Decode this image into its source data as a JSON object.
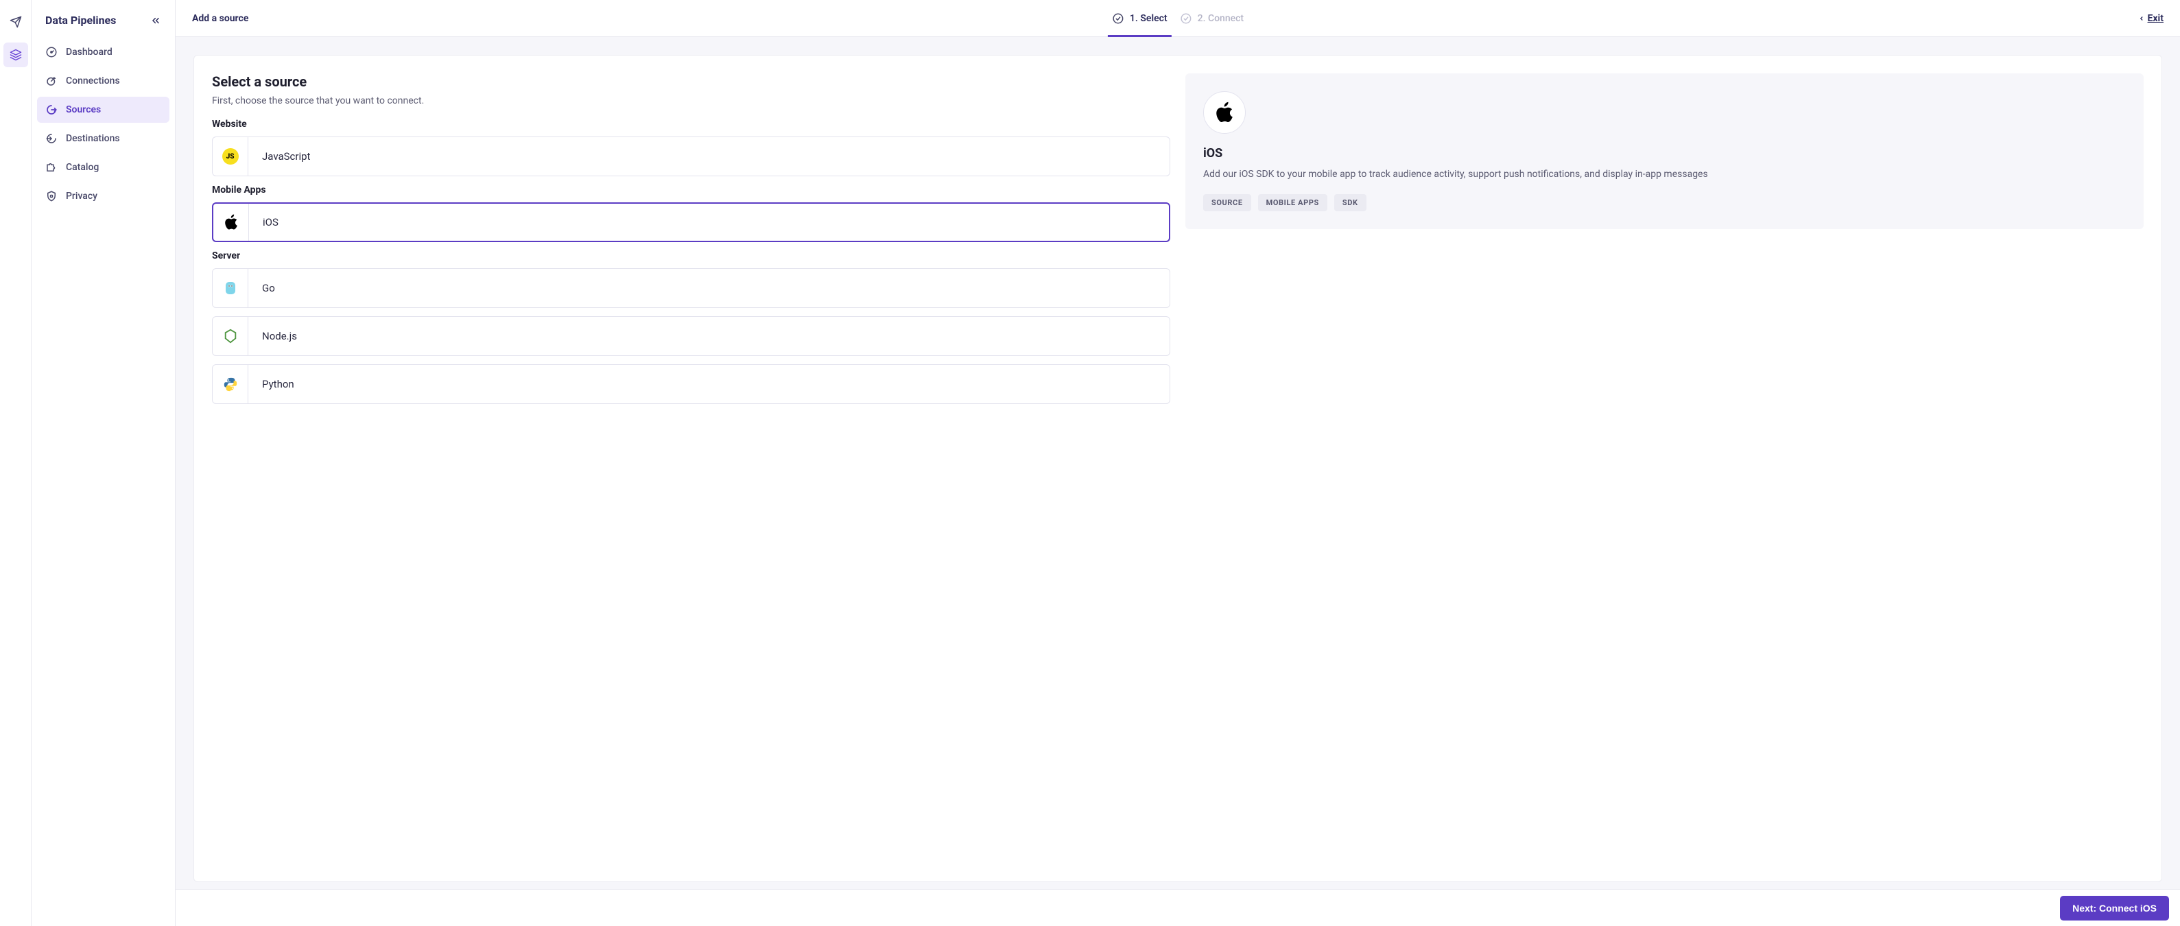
{
  "rail": {
    "items": [
      "paper-plane-icon",
      "layers-icon"
    ]
  },
  "sidebar": {
    "title": "Data Pipelines",
    "items": [
      {
        "label": "Dashboard"
      },
      {
        "label": "Connections"
      },
      {
        "label": "Sources"
      },
      {
        "label": "Destinations"
      },
      {
        "label": "Catalog"
      },
      {
        "label": "Privacy"
      }
    ]
  },
  "topbar": {
    "title": "Add a source",
    "steps": [
      {
        "label": "1. Select"
      },
      {
        "label": "2. Connect"
      }
    ],
    "exit": "Exit"
  },
  "content": {
    "title": "Select a source",
    "description": "First, choose the source that you want to connect.",
    "groups": [
      {
        "label": "Website",
        "items": [
          {
            "label": "JavaScript"
          }
        ]
      },
      {
        "label": "Mobile Apps",
        "items": [
          {
            "label": "iOS"
          }
        ]
      },
      {
        "label": "Server",
        "items": [
          {
            "label": "Go"
          },
          {
            "label": "Node.js"
          },
          {
            "label": "Python"
          }
        ]
      }
    ]
  },
  "detail": {
    "title": "iOS",
    "description": "Add our iOS SDK to your mobile app to track audience activity, support push notifications, and display in-app messages",
    "tags": [
      "SOURCE",
      "MOBILE APPS",
      "SDK"
    ]
  },
  "footer": {
    "cta": "Next: Connect iOS"
  }
}
